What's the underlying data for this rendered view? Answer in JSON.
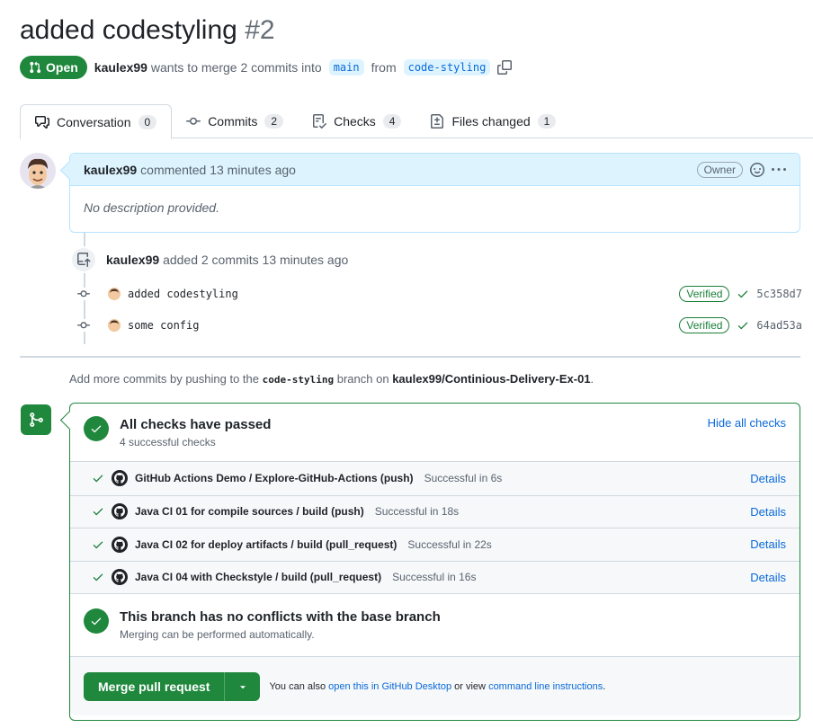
{
  "pr": {
    "title": "added codestyling",
    "number": "#2",
    "state": "Open",
    "author": "kaulex99",
    "merge_text": "wants to merge 2 commits into",
    "base_branch": "main",
    "from_text": "from",
    "head_branch": "code-styling"
  },
  "tabs": [
    {
      "label": "Conversation",
      "count": "0"
    },
    {
      "label": "Commits",
      "count": "2"
    },
    {
      "label": "Checks",
      "count": "4"
    },
    {
      "label": "Files changed",
      "count": "1"
    }
  ],
  "comment": {
    "author": "kaulex99",
    "action": "commented 13 minutes ago",
    "role": "Owner",
    "body": "No description provided."
  },
  "commit_event": {
    "author": "kaulex99",
    "text": "added 2 commits 13 minutes ago"
  },
  "commits": [
    {
      "message": "added codestyling",
      "verified": "Verified",
      "sha": "5c358d7"
    },
    {
      "message": "some config",
      "verified": "Verified",
      "sha": "64ad53a"
    }
  ],
  "push_hint": {
    "prefix": "Add more commits by pushing to the",
    "branch": "code-styling",
    "middle": "branch on",
    "repo": "kaulex99/Continious-Delivery-Ex-01",
    "suffix": "."
  },
  "checks": {
    "title": "All checks have passed",
    "subtitle": "4 successful checks",
    "hide_label": "Hide all checks",
    "items": [
      {
        "name": "GitHub Actions Demo / Explore-GitHub-Actions (push)",
        "status": "Successful in 6s",
        "details": "Details"
      },
      {
        "name": "Java CI 01 for compile sources / build (push)",
        "status": "Successful in 18s",
        "details": "Details"
      },
      {
        "name": "Java CI 02 for deploy artifacts / build (pull_request)",
        "status": "Successful in 22s",
        "details": "Details"
      },
      {
        "name": "Java CI 04 with Checkstyle / build (pull_request)",
        "status": "Successful in 16s",
        "details": "Details"
      }
    ]
  },
  "conflicts": {
    "title": "This branch has no conflicts with the base branch",
    "subtitle": "Merging can be performed automatically."
  },
  "merge": {
    "button_label": "Merge pull request",
    "also_text": "You can also",
    "desktop_link": "open this in GitHub Desktop",
    "or_view": "or view",
    "cli_link": "command line instructions",
    "end": "."
  },
  "colors": {
    "success": "#1f883d",
    "link": "#0969da",
    "comment_header": "#ddf4ff"
  }
}
